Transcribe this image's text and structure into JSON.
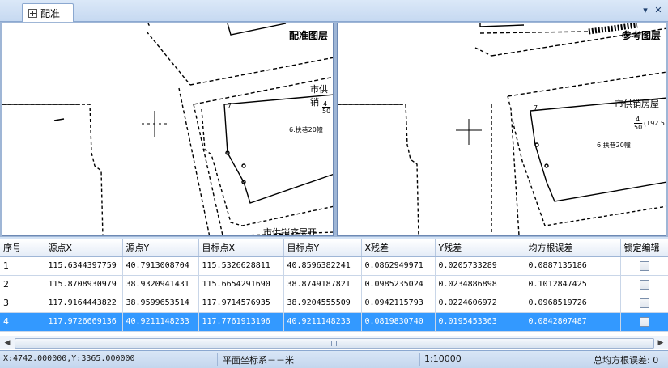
{
  "tab": {
    "label": "配准"
  },
  "window_buttons": {
    "dropdown": "▾",
    "close": "✕"
  },
  "panes": {
    "left": {
      "title": "配准图层",
      "map_text_1": "市供销",
      "map_text_2": "市供销底层开",
      "map_text_3": "4",
      "map_text_4": "50",
      "map_text_5": "6.扶巷20幢",
      "map_text_6": "7"
    },
    "right": {
      "title": "参考图层",
      "map_text_1": "市供销房屋",
      "map_text_2": "4",
      "map_text_3": "50",
      "map_text_4": "(192.5",
      "map_text_5": "6.扶巷20幢",
      "map_text_6": "7"
    }
  },
  "grid": {
    "columns": [
      "序号",
      "源点X",
      "源点Y",
      "目标点X",
      "目标点Y",
      "X残差",
      "Y残差",
      "均方根误差",
      "锁定编辑"
    ],
    "rows": [
      {
        "idx": "1",
        "sx": "115.6344397759",
        "sy": "40.7913008704",
        "tx": "115.5326628811",
        "ty": "40.8596382241",
        "rx": "0.0862949971",
        "ry": "0.0205733289",
        "rms": "0.0887135186",
        "locked": false,
        "selected": false
      },
      {
        "idx": "2",
        "sx": "115.8708930979",
        "sy": "38.9320941431",
        "tx": "115.6654291690",
        "ty": "38.8749187821",
        "rx": "0.0985235024",
        "ry": "0.0234886898",
        "rms": "0.1012847425",
        "locked": false,
        "selected": false
      },
      {
        "idx": "3",
        "sx": "117.9164443822",
        "sy": "38.9599653514",
        "tx": "117.9714576935",
        "ty": "38.9204555509",
        "rx": "0.0942115793",
        "ry": "0.0224606972",
        "rms": "0.0968519726",
        "locked": false,
        "selected": false
      },
      {
        "idx": "4",
        "sx": "117.9726669136",
        "sy": "40.9211148233",
        "tx": "117.7761913196",
        "ty": "40.9211148233",
        "rx": "0.0819830740",
        "ry": "0.0195453363",
        "rms": "0.0842807487",
        "locked": false,
        "selected": true
      }
    ]
  },
  "status": {
    "coords": "X:4742.000000,Y:3365.000000",
    "crs": "平面坐标系－－米",
    "scale": "1:10000",
    "rms_total": "总均方根误差: 0"
  },
  "colors": {
    "selected_row": "#3399ff",
    "accent": "#8ba8d0"
  }
}
